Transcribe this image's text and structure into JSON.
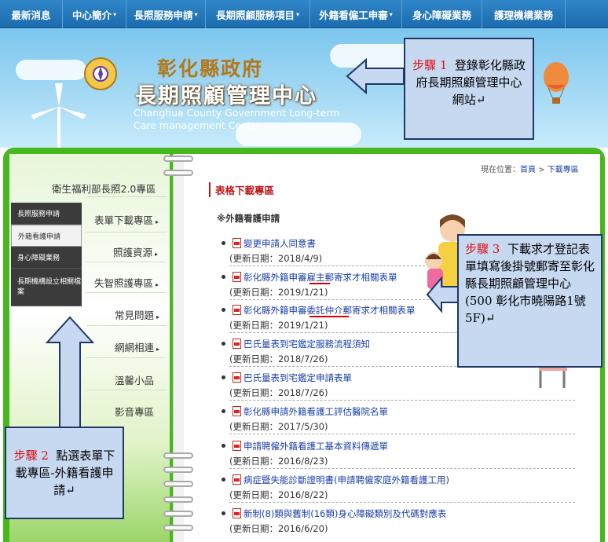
{
  "nav": {
    "items": [
      {
        "label": "最新消息",
        "dropdown": false
      },
      {
        "label": "中心簡介",
        "dropdown": true
      },
      {
        "label": "長照服務申請",
        "dropdown": true
      },
      {
        "label": "長期照顧服務項目",
        "dropdown": true
      },
      {
        "label": "外籍看僱工申審",
        "dropdown": true
      },
      {
        "label": "身心障礙業務",
        "dropdown": false
      },
      {
        "label": "護理機構業務",
        "dropdown": false
      }
    ]
  },
  "banner": {
    "title_line1": "彰化縣政府",
    "title_line2": "長期照顧管理中心",
    "en_line1": "Changhua County Government Long-term",
    "en_line2": "Care management Center"
  },
  "sidebar": {
    "promo": "衛生福利部長照2.0專區",
    "links": [
      {
        "label": "表單下載專區",
        "arrow": "▸"
      },
      {
        "label": "照護資源",
        "arrow": "▸"
      },
      {
        "label": "失智照護專區",
        "arrow": "▸"
      },
      {
        "label": "常見問題",
        "arrow": "▸"
      },
      {
        "label": "網網相連",
        "arrow": "▸"
      },
      {
        "label": "溫馨小品",
        "arrow": ""
      },
      {
        "label": "影音專區",
        "arrow": ""
      }
    ],
    "submenu": [
      {
        "label": "長照服務申請"
      },
      {
        "label": "外籍看護申請"
      },
      {
        "label": "身心障礙業務"
      },
      {
        "label": "長期機構設立相關檔案"
      }
    ]
  },
  "content": {
    "breadcrumb_prefix": "現在位置：",
    "breadcrumb_home": "首頁",
    "breadcrumb_sep": " > ",
    "breadcrumb_current": "下載專區",
    "title": "表格下載專區",
    "section": "※外籍看護申請",
    "docs": [
      {
        "title": "變更申請人同意書",
        "date": "(更新日期：2018/4/9)"
      },
      {
        "title": "彰化縣外籍申審雇主郵寄求才相關表單",
        "date": "(更新日期：2019/1/21)"
      },
      {
        "title": "彰化縣外籍申審委託仲介郵寄求才相關表單",
        "date": "(更新日期：2019/1/21)"
      },
      {
        "title": "巴氏量表到宅鑑定服務流程須知",
        "date": "(更新日期：2018/7/26)"
      },
      {
        "title": "巴氏量表到宅鑑定申請表單",
        "date": "(更新日期：2018/7/26)"
      },
      {
        "title": "彰化縣申請外籍看護工評估醫院名單",
        "date": "(更新日期：2017/5/30)"
      },
      {
        "title": "申請聘僱外籍看護工基本資料傳遞單",
        "date": "(更新日期：2016/8/23)"
      },
      {
        "title": "病症暨失能診斷證明書(申請聘僱家庭外籍看護工用)",
        "date": "(更新日期：2016/8/22)"
      },
      {
        "title": "新制(8)類與舊制(16類)身心障礙類別及代碼對應表",
        "date": "(更新日期：2016/6/20)"
      }
    ]
  },
  "callouts": {
    "step1_label": "步驟 1",
    "step1_text": "登錄彰化縣政府長期照顧管理中心網站",
    "step1_mark": "↵",
    "step2_label": "步驟 2",
    "step2_text": "點選表單下載專區-外籍看護申請",
    "step2_mark": "↵",
    "step3_label": "步驟 3",
    "step3_text": "下載求才登記表單填寫後掛號郵寄至彰化縣長期照顧管理中心(500 彰化市曉陽路1號5F)",
    "step3_mark": "↵"
  },
  "colors": {
    "nav": "#1c6cae",
    "frame_green": "#46b81e",
    "callout_bg": "#c6d9f1",
    "callout_border": "#1f3864",
    "step_red": "#e01010",
    "link_blue": "#1a3ea8",
    "title_red": "#c0181a"
  }
}
